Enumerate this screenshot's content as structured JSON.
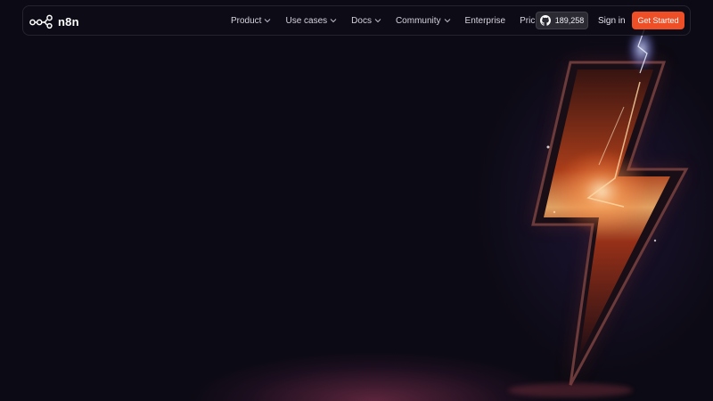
{
  "brand": {
    "name": "n8n",
    "logo_icon": "n8n-nodes-logo-icon"
  },
  "nav": {
    "items": [
      {
        "label": "Product",
        "has_dropdown": true
      },
      {
        "label": "Use cases",
        "has_dropdown": true
      },
      {
        "label": "Docs",
        "has_dropdown": true
      },
      {
        "label": "Community",
        "has_dropdown": true
      },
      {
        "label": "Enterprise",
        "has_dropdown": false
      },
      {
        "label": "Pricing",
        "has_dropdown": false
      }
    ]
  },
  "github": {
    "icon": "github-icon",
    "stars": "189,258"
  },
  "actions": {
    "sign_in": "Sign in",
    "get_started": "Get Started"
  },
  "hero": {
    "art_icon": "lightning-bolt-icon"
  },
  "colors": {
    "background": "#0c0a14",
    "accent": "#ee4f27",
    "nav_text": "#d6d3df",
    "github_button": "#2b2a33"
  }
}
